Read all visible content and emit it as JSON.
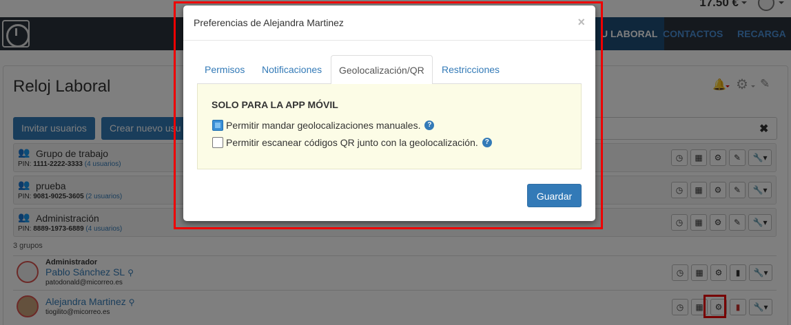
{
  "topbar": {
    "balance": "17.50 €"
  },
  "nav": {
    "items": [
      {
        "label": "U LABORAL",
        "active": true
      },
      {
        "label": "CONTACTOS",
        "active": false
      },
      {
        "label": "RECARGA",
        "active": false
      }
    ]
  },
  "page": {
    "title": "Reloj Laboral",
    "buttons": {
      "invite": "Invitar usuarios",
      "create": "Crear nuevo usu"
    },
    "groups": [
      {
        "name": "Grupo de trabajo",
        "pin_label": "PIN:",
        "pin": "1111-2222-3333",
        "users": "(4 usuarios)"
      },
      {
        "name": "prueba",
        "pin_label": "PIN:",
        "pin": "9081-9025-3605",
        "users": "(2 usuarios)"
      },
      {
        "name": "Administración",
        "pin_label": "PIN:",
        "pin": "8889-1973-6889",
        "users": "(4 usuarios)"
      }
    ],
    "groups_count": "3 grupos",
    "users": [
      {
        "role": "Administrador",
        "name": "Pablo Sánchez SL",
        "email": "patodonald@micorreo.es"
      },
      {
        "role": "",
        "name": "Alejandra Martinez",
        "email": "tiogilito@micorreo.es"
      }
    ]
  },
  "modal": {
    "title": "Preferencias de Alejandra Martinez",
    "close": "×",
    "tabs": [
      {
        "label": "Permisos",
        "active": false
      },
      {
        "label": "Notificaciones",
        "active": false
      },
      {
        "label": "Geolocalización/QR",
        "active": true
      },
      {
        "label": "Restricciones",
        "active": false
      }
    ],
    "panel_title": "SOLO PARA LA APP MÓVIL",
    "options": [
      {
        "label": "Permitir mandar geolocalizaciones manuales.",
        "checked": true
      },
      {
        "label": "Permitir escanear códigos QR junto con la geolocalización.",
        "checked": false
      }
    ],
    "help": "?",
    "save_label": "Guardar"
  },
  "colors": {
    "accent": "#337ab7",
    "navbar": "#2a333d",
    "highlight": "#ee0000",
    "panel_bg": "#fcfce6"
  }
}
